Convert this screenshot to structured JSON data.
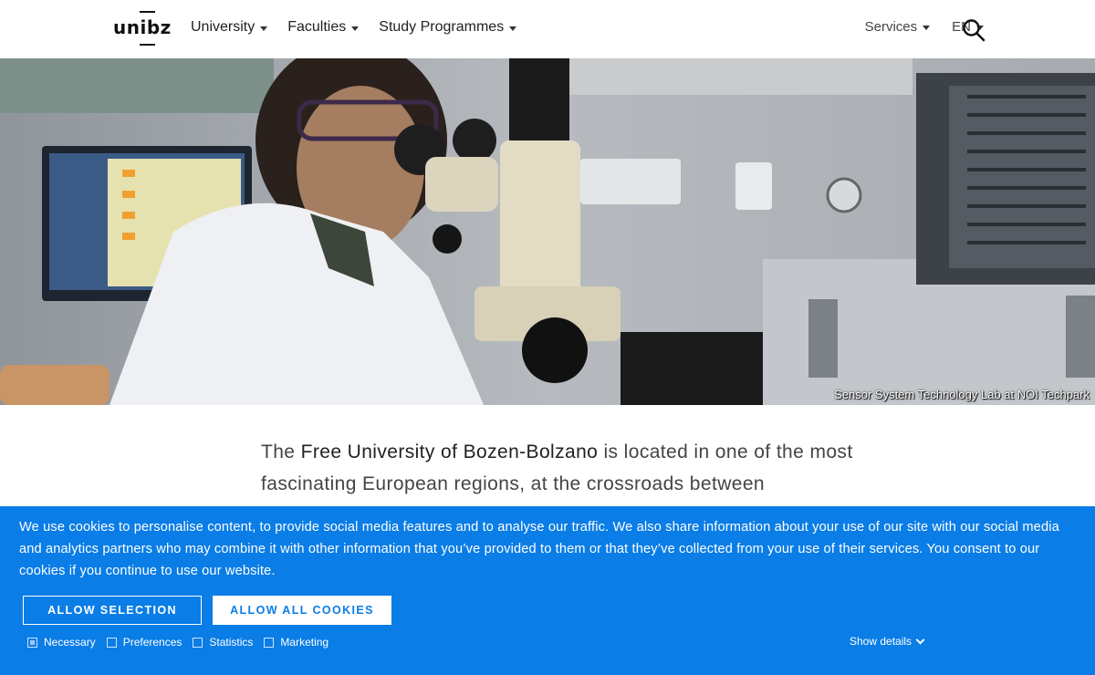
{
  "header": {
    "logo_text": "unibz",
    "nav": [
      {
        "label": "University"
      },
      {
        "label": "Faculties"
      },
      {
        "label": "Study Programmes"
      }
    ],
    "services_label": "Services",
    "language_label": "EN",
    "search_icon": "search-icon"
  },
  "hero": {
    "caption": "Sensor System Technology Lab at NOI Techpark"
  },
  "intro": {
    "prefix": "The ",
    "highlight": "Free University of Bozen-Bolzano",
    "suffix": " is located in one of the most fascinating European regions, at the crossroads between"
  },
  "cookie_banner": {
    "text": "We use cookies to personalise content, to provide social media features and to analyse our traffic. We also share information about your use of our site with our social media and analytics partners who may combine it with other information that you’ve provided to them or that they’ve collected from your use of their services. You consent to our cookies if you continue to use our website.",
    "allow_selection_label": "ALLOW SELECTION",
    "allow_all_label": "ALLOW ALL COOKIES",
    "checkboxes": [
      {
        "label": "Necessary",
        "checked": true
      },
      {
        "label": "Preferences",
        "checked": false
      },
      {
        "label": "Statistics",
        "checked": false
      },
      {
        "label": "Marketing",
        "checked": false
      }
    ],
    "show_details_label": "Show details",
    "background_color": "#0a7de6"
  }
}
